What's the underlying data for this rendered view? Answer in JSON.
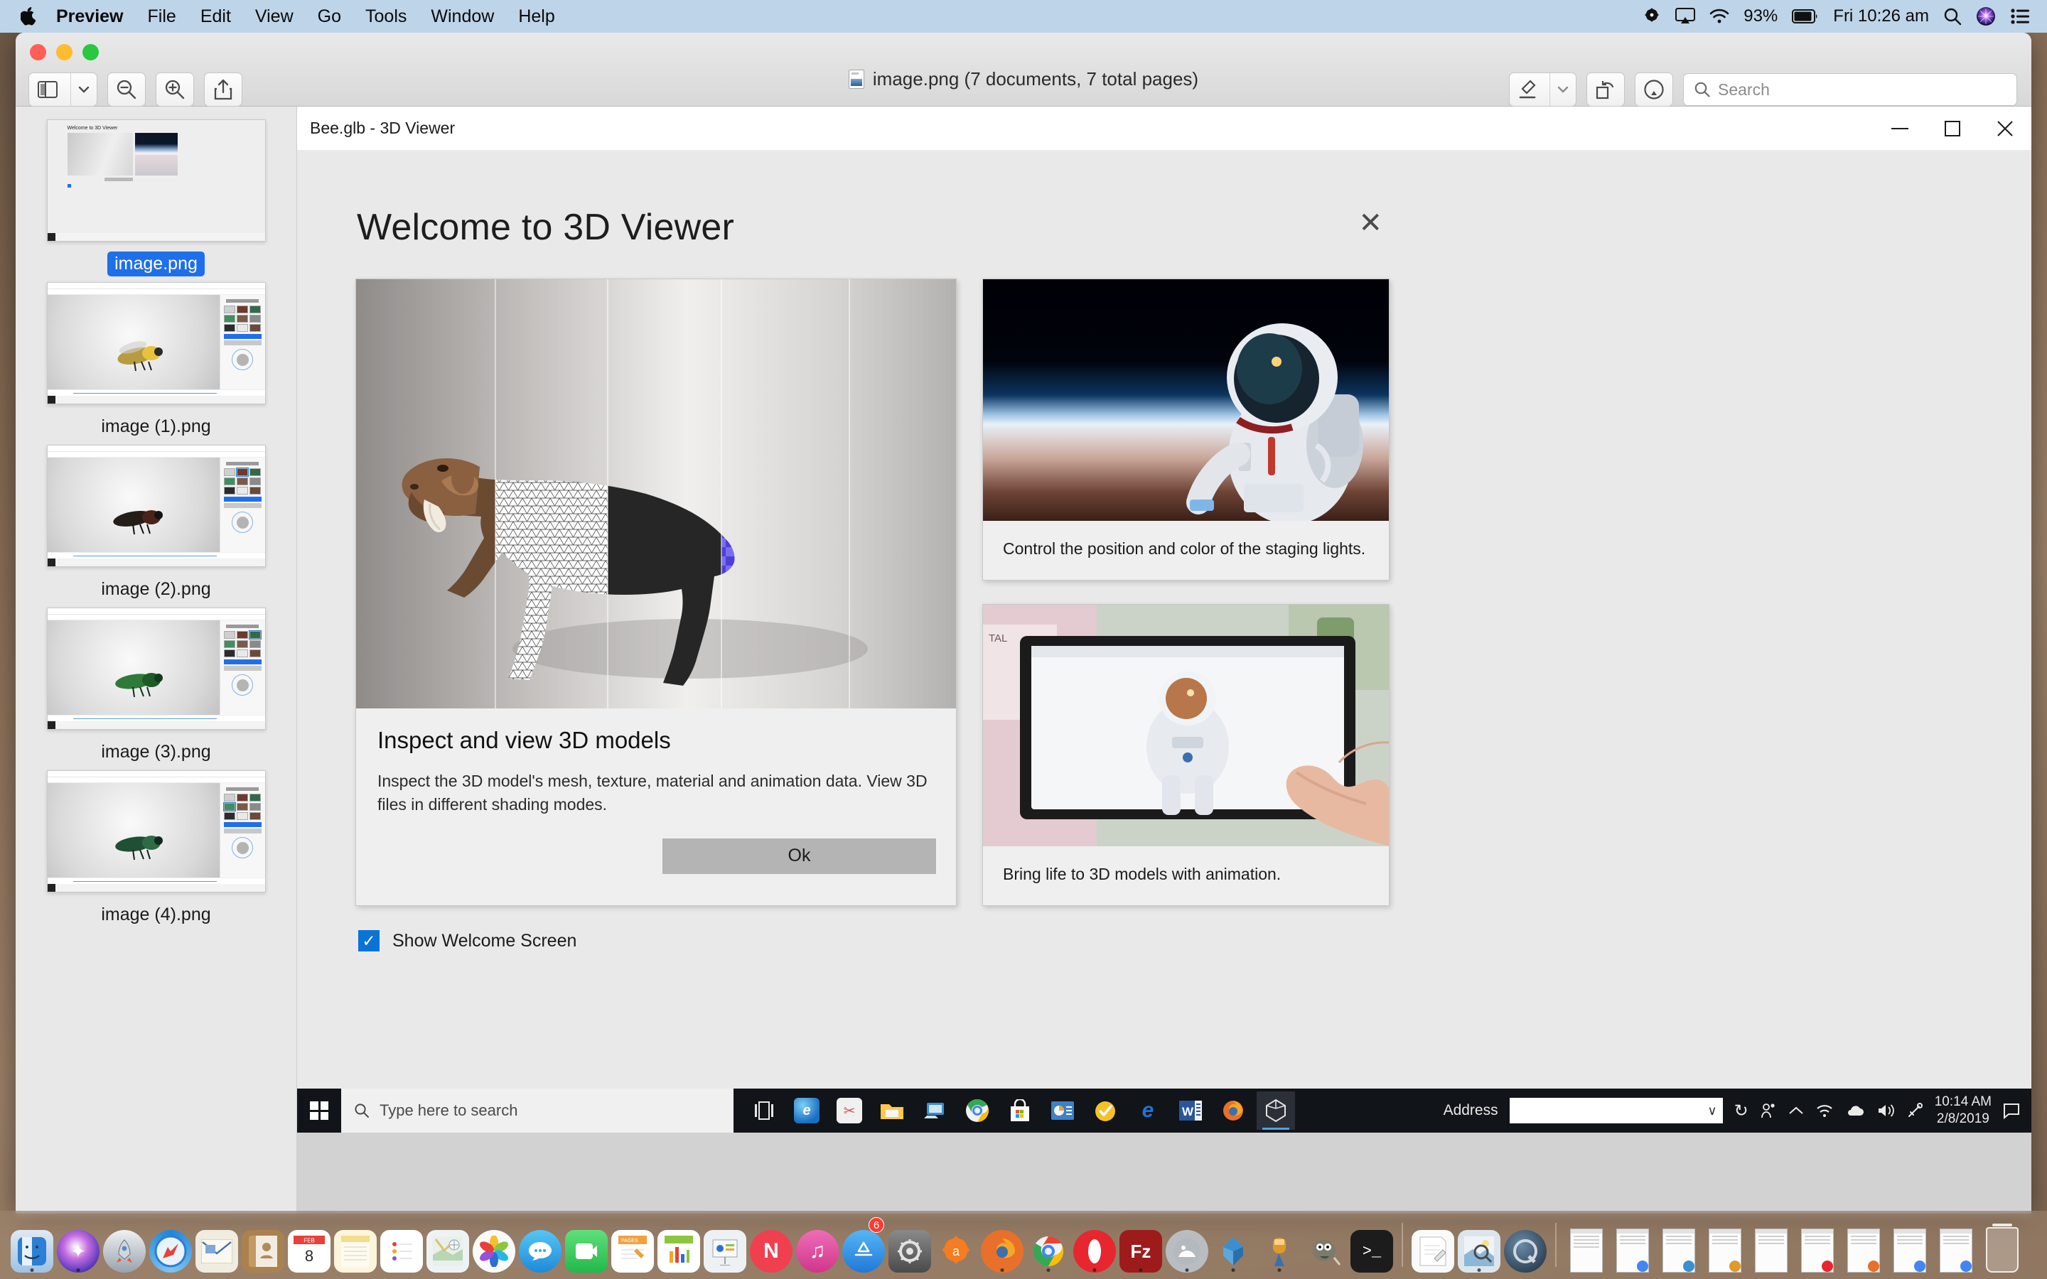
{
  "menubar": {
    "apple_icon": "apple-logo-icon",
    "items": [
      {
        "label": "Preview",
        "bold": true
      },
      {
        "label": "File",
        "bold": false
      },
      {
        "label": "Edit",
        "bold": false
      },
      {
        "label": "View",
        "bold": false
      },
      {
        "label": "Go",
        "bold": false
      },
      {
        "label": "Tools",
        "bold": false
      },
      {
        "label": "Window",
        "bold": false
      },
      {
        "label": "Help",
        "bold": false
      }
    ],
    "status": {
      "app_extra_icon": "avast-icon",
      "airplay_icon": "airplay-icon",
      "wifi_icon": "wifi-icon",
      "battery_percent": "93%",
      "battery_icon": "battery-icon",
      "clock": "Fri 10:26 am",
      "spotlight_icon": "search-icon",
      "siri_icon": "siri-icon",
      "control_center_icon": "control-center-icon"
    }
  },
  "preview": {
    "window_title": "image.png (7 documents, 7 total pages)",
    "doc_icon": "image-file-icon",
    "toolbar_left": [
      {
        "name": "sidebar-toggle",
        "icon": "sidebar-icon",
        "has_chevron": true
      },
      {
        "name": "zoom-out",
        "icon": "magnifier-minus-icon"
      },
      {
        "name": "zoom-in",
        "icon": "magnifier-plus-icon"
      },
      {
        "name": "share",
        "icon": "share-icon"
      }
    ],
    "toolbar_right": [
      {
        "name": "markup-highlight",
        "icon": "highlighter-pen-icon",
        "has_chevron": true
      },
      {
        "name": "rotate",
        "icon": "rotate-icon"
      },
      {
        "name": "markup",
        "icon": "markup-pen-icon"
      }
    ],
    "search": {
      "placeholder": "Search",
      "value": "",
      "icon": "search-icon"
    },
    "traffic_lights": [
      "close",
      "minimize",
      "maximize"
    ],
    "sidebar": {
      "items": [
        {
          "label": "image.png",
          "selected": true,
          "kind": "welcome"
        },
        {
          "label": "image (1).png",
          "selected": false,
          "kind": "bee",
          "bee_color": "#b9a martin"
        },
        {
          "label": "image (2).png",
          "selected": false,
          "kind": "bee"
        },
        {
          "label": "image (3).png",
          "selected": false,
          "kind": "bee"
        },
        {
          "label": "image (4).png",
          "selected": false,
          "kind": "bee"
        }
      ]
    }
  },
  "viewer_window": {
    "title": "Bee.glb - 3D Viewer",
    "window_buttons": [
      {
        "name": "minimize-button",
        "glyph": "–"
      },
      {
        "name": "maximize-button",
        "glyph": "❐"
      },
      {
        "name": "close-button",
        "glyph": "✕"
      }
    ]
  },
  "welcome_dialog": {
    "title": "Welcome to 3D Viewer",
    "close_glyph": "✕",
    "main_card": {
      "heading": "Inspect and view 3D models",
      "body": "Inspect the 3D model's mesh, texture, material and animation data. View 3D files in different shading modes.",
      "ok_label": "Ok",
      "hero_alt": "saber-toothed-cat-shading-modes"
    },
    "side_cards": [
      {
        "caption": "Control the position and color of the staging lights.",
        "image_alt": "astronaut-in-space"
      },
      {
        "caption": "Bring life to 3D models with animation.",
        "image_alt": "hand-touching-tablet-with-astronaut"
      }
    ],
    "checkbox": {
      "label": "Show Welcome Screen",
      "checked": true,
      "color": "#0a73d6",
      "check_glyph": "✓"
    }
  },
  "windows_taskbar": {
    "start_icon": "windows-logo-icon",
    "search_placeholder": "Type here to search",
    "search_icon": "search-icon",
    "apps": [
      {
        "name": "task-view-icon",
        "glyph": "⌸",
        "color": "#1b1b1b",
        "active": false
      },
      {
        "name": "internet-explorer-icon",
        "glyph": "e",
        "color": "#1a6fc4",
        "active": false
      },
      {
        "name": "snipping-tool-icon",
        "glyph": "✂",
        "color": "#d94f4f",
        "active": false
      },
      {
        "name": "file-explorer-icon",
        "glyph": "▭",
        "color": "#ffc84a",
        "active": false
      },
      {
        "name": "remote-desktop-icon",
        "glyph": "▣",
        "color": "#3a8fd0",
        "active": false
      },
      {
        "name": "google-chrome-icon",
        "glyph": "●",
        "color": "#4285f4",
        "active": false
      },
      {
        "name": "microsoft-store-icon",
        "glyph": "⊞",
        "color": "#f3f3f3",
        "active": false
      },
      {
        "name": "powerpoint-icon",
        "glyph": "P",
        "color": "#3d81c6",
        "active": false
      },
      {
        "name": "norton-icon",
        "glyph": "✓",
        "color": "#f5c028",
        "active": false
      },
      {
        "name": "microsoft-edge-icon",
        "glyph": "e",
        "color": "#1f5fbf",
        "active": false
      },
      {
        "name": "word-icon",
        "glyph": "W",
        "color": "#2a5699",
        "active": false
      },
      {
        "name": "firefox-icon",
        "glyph": "◉",
        "color": "#e8702a",
        "active": false
      },
      {
        "name": "3d-viewer-icon",
        "glyph": "⬡",
        "color": "#dedede",
        "active": true
      }
    ],
    "tray": {
      "address_label": "Address",
      "address_value": "",
      "dropdown_glyph": "∨",
      "refresh_glyph": "↻",
      "people_icon": "people-icon",
      "chevron_up_icon": "chevron-up-icon",
      "network_icon": "network-icon",
      "onedrive_icon": "onedrive-cloud-icon",
      "volume_icon": "volume-icon",
      "pen_icon": "pen-icon",
      "time": "10:14 AM",
      "date": "2/8/2019",
      "notifications_icon": "notification-icon"
    }
  },
  "dock": {
    "items": [
      {
        "name": "finder",
        "color": "#2b7fd4",
        "glyph": "⌣",
        "shape": "rect",
        "running": true
      },
      {
        "name": "siri",
        "color": "#2b2b3f",
        "glyph": "✦",
        "shape": "circle",
        "running": true
      },
      {
        "name": "launchpad",
        "color": "#9aa2ad",
        "glyph": "▲",
        "shape": "circle",
        "running": false
      },
      {
        "name": "safari",
        "color": "#1f86d8",
        "glyph": "❂",
        "shape": "circle",
        "running": false
      },
      {
        "name": "mail",
        "color": "#e8e2d2",
        "glyph": "✉",
        "shape": "rect",
        "running": false
      },
      {
        "name": "contacts",
        "color": "#a9824f",
        "glyph": "▤",
        "shape": "rect",
        "running": false
      },
      {
        "name": "calendar",
        "color": "#ffffff",
        "glyph": "8",
        "shape": "rect",
        "running": false,
        "badge_top": "FEB"
      },
      {
        "name": "notes",
        "color": "#fbe9a8",
        "glyph": "≡",
        "shape": "rect",
        "running": false
      },
      {
        "name": "reminders",
        "color": "#fbfbfb",
        "glyph": "•",
        "shape": "rect",
        "running": false
      },
      {
        "name": "maps",
        "color": "#e9eef0",
        "glyph": "➤",
        "shape": "rect",
        "running": false
      },
      {
        "name": "photos",
        "color": "#f4f4f4",
        "glyph": "✿",
        "shape": "circle",
        "running": false
      },
      {
        "name": "messages",
        "color": "#3bb0f0",
        "glyph": "●●●",
        "shape": "circle",
        "running": false
      },
      {
        "name": "facetime",
        "color": "#2fc85c",
        "glyph": "☎",
        "shape": "rect",
        "running": false
      },
      {
        "name": "pages",
        "color": "#f4a13c",
        "glyph": "✎",
        "shape": "rect",
        "running": false
      },
      {
        "name": "numbers",
        "color": "#f7f7f7",
        "glyph": "▂",
        "shape": "rect",
        "running": false
      },
      {
        "name": "keynote",
        "color": "#eef1f4",
        "glyph": "▦",
        "shape": "rect",
        "running": false
      },
      {
        "name": "news",
        "color": "#f04050",
        "glyph": "N",
        "shape": "circle",
        "running": false
      },
      {
        "name": "itunes",
        "color": "#e0519a",
        "glyph": "♫",
        "shape": "circle",
        "running": false
      },
      {
        "name": "app-store",
        "color": "#2b8ae8",
        "glyph": "A",
        "shape": "circle",
        "running": false,
        "badge": "6"
      },
      {
        "name": "system-preferences",
        "color": "#6a6a6a",
        "glyph": "⚙",
        "shape": "rect",
        "running": false
      },
      {
        "name": "avast",
        "color": "#f57c20",
        "glyph": "a",
        "shape": "rect",
        "running": false
      },
      {
        "name": "firefox",
        "color": "#e8702a",
        "glyph": "◉",
        "shape": "circle",
        "running": true
      },
      {
        "name": "google-chrome",
        "color": "#4285f4",
        "glyph": "●",
        "shape": "circle",
        "running": true
      },
      {
        "name": "opera",
        "color": "#e8262f",
        "glyph": "O",
        "shape": "circle",
        "running": true
      },
      {
        "name": "filezilla",
        "color": "#9e1b1b",
        "glyph": "Fz",
        "shape": "rect",
        "running": true
      },
      {
        "name": "elephant-sql",
        "color": "#b9bdc2",
        "glyph": "◔",
        "shape": "circle",
        "running": true
      },
      {
        "name": "xcode",
        "color": "#3a8fd0",
        "glyph": "➤",
        "shape": "rect",
        "running": true
      },
      {
        "name": "mamp",
        "color": "#e09a2b",
        "glyph": "▀",
        "shape": "rect",
        "running": true
      },
      {
        "name": "gimp",
        "color": "#7b7b6b",
        "glyph": "◑",
        "shape": "rect",
        "running": false
      },
      {
        "name": "terminal",
        "color": "#1c1c1c",
        "glyph": ">_",
        "shape": "rect",
        "running": true
      },
      {
        "name": "separator-1",
        "shape": "sep"
      },
      {
        "name": "textedit",
        "color": "#f7f7f7",
        "glyph": "✏",
        "shape": "rect",
        "running": false
      },
      {
        "name": "preview",
        "color": "#cfd8e0",
        "glyph": "▰",
        "shape": "rect",
        "running": true
      },
      {
        "name": "quicktime",
        "color": "#2b3f52",
        "glyph": "Q",
        "shape": "circle",
        "running": false
      },
      {
        "name": "separator-2",
        "shape": "sep"
      },
      {
        "name": "minimized-window-1",
        "shape": "mini",
        "color": "#9aa0a6"
      },
      {
        "name": "minimized-window-2",
        "shape": "mini",
        "color": "#4285f4"
      },
      {
        "name": "minimized-window-3",
        "shape": "mini",
        "color": "#3a8fd0"
      },
      {
        "name": "minimized-window-4",
        "shape": "mini",
        "color": "#e09a2b"
      },
      {
        "name": "minimized-window-5",
        "shape": "mini",
        "color": "#e09a2b"
      },
      {
        "name": "minimized-window-6",
        "shape": "mini",
        "color": "#e8262f"
      },
      {
        "name": "minimized-window-7",
        "shape": "mini",
        "color": "#e8702a"
      },
      {
        "name": "minimized-window-8",
        "shape": "mini",
        "color": "#4285f4"
      },
      {
        "name": "minimized-window-9",
        "shape": "mini",
        "color": "#4285f4"
      },
      {
        "name": "trash",
        "shape": "trash"
      }
    ]
  }
}
